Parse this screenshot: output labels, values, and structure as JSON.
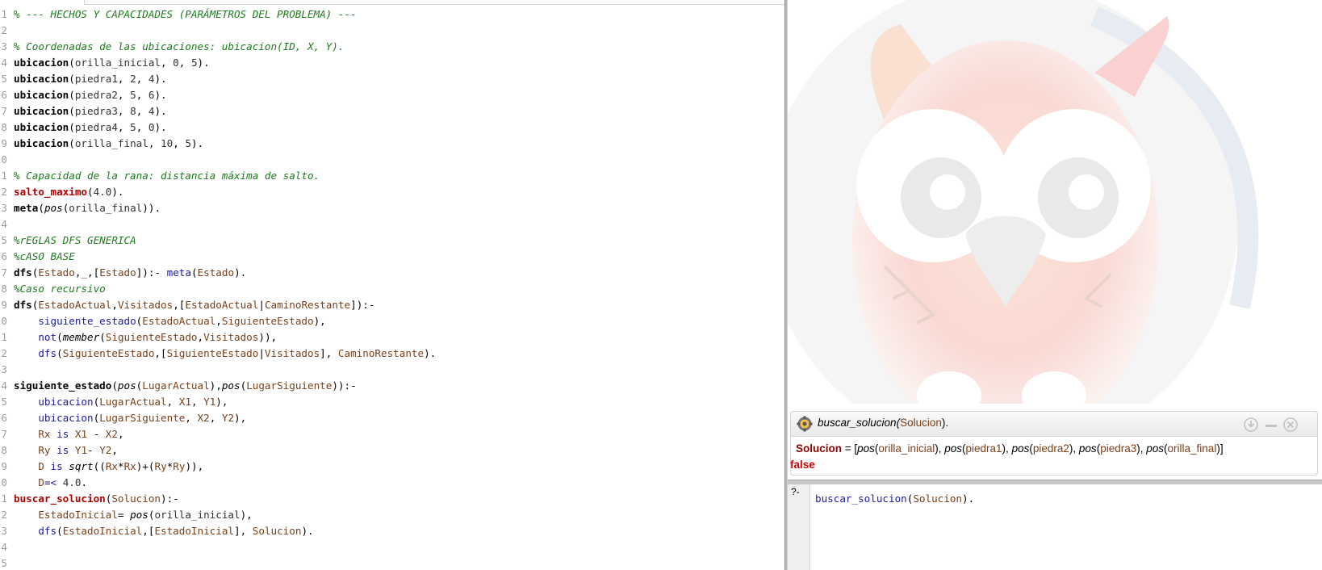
{
  "editor": {
    "lines": [
      {
        "n": "1",
        "tokens": [
          {
            "t": "% --- HECHOS Y CAPACIDADES (PARÁMETROS DEL PROBLEMA) ---",
            "c": "cm"
          }
        ]
      },
      {
        "n": "2",
        "tokens": []
      },
      {
        "n": "3",
        "tokens": [
          {
            "t": "% Coordenadas de las ubicaciones: ubicacion(ID, X, Y).",
            "c": "cm"
          }
        ]
      },
      {
        "n": "4",
        "tokens": [
          {
            "t": "ubicacion",
            "c": "hd"
          },
          {
            "t": "(",
            "c": "pn"
          },
          {
            "t": "orilla_inicial",
            "c": "at"
          },
          {
            "t": ", ",
            "c": "pn"
          },
          {
            "t": "0",
            "c": "nm"
          },
          {
            "t": ", ",
            "c": "pn"
          },
          {
            "t": "5",
            "c": "nm"
          },
          {
            "t": ").",
            "c": "pn"
          }
        ]
      },
      {
        "n": "5",
        "tokens": [
          {
            "t": "ubicacion",
            "c": "hd"
          },
          {
            "t": "(",
            "c": "pn"
          },
          {
            "t": "piedra1",
            "c": "at"
          },
          {
            "t": ", ",
            "c": "pn"
          },
          {
            "t": "2",
            "c": "nm"
          },
          {
            "t": ", ",
            "c": "pn"
          },
          {
            "t": "4",
            "c": "nm"
          },
          {
            "t": ").",
            "c": "pn"
          }
        ]
      },
      {
        "n": "6",
        "tokens": [
          {
            "t": "ubicacion",
            "c": "hd"
          },
          {
            "t": "(",
            "c": "pn"
          },
          {
            "t": "piedra2",
            "c": "at"
          },
          {
            "t": ", ",
            "c": "pn"
          },
          {
            "t": "5",
            "c": "nm"
          },
          {
            "t": ", ",
            "c": "pn"
          },
          {
            "t": "6",
            "c": "nm"
          },
          {
            "t": ").",
            "c": "pn"
          }
        ]
      },
      {
        "n": "7",
        "tokens": [
          {
            "t": "ubicacion",
            "c": "hd"
          },
          {
            "t": "(",
            "c": "pn"
          },
          {
            "t": "piedra3",
            "c": "at"
          },
          {
            "t": ", ",
            "c": "pn"
          },
          {
            "t": "8",
            "c": "nm"
          },
          {
            "t": ", ",
            "c": "pn"
          },
          {
            "t": "4",
            "c": "nm"
          },
          {
            "t": ").",
            "c": "pn"
          }
        ]
      },
      {
        "n": "8",
        "tokens": [
          {
            "t": "ubicacion",
            "c": "hd"
          },
          {
            "t": "(",
            "c": "pn"
          },
          {
            "t": "piedra4",
            "c": "at"
          },
          {
            "t": ", ",
            "c": "pn"
          },
          {
            "t": "5",
            "c": "nm"
          },
          {
            "t": ", ",
            "c": "pn"
          },
          {
            "t": "0",
            "c": "nm"
          },
          {
            "t": ").",
            "c": "pn"
          }
        ]
      },
      {
        "n": "9",
        "tokens": [
          {
            "t": "ubicacion",
            "c": "hd"
          },
          {
            "t": "(",
            "c": "pn"
          },
          {
            "t": "orilla_final",
            "c": "at"
          },
          {
            "t": ", ",
            "c": "pn"
          },
          {
            "t": "10",
            "c": "nm"
          },
          {
            "t": ", ",
            "c": "pn"
          },
          {
            "t": "5",
            "c": "nm"
          },
          {
            "t": ").",
            "c": "pn"
          }
        ]
      },
      {
        "n": "0",
        "tokens": []
      },
      {
        "n": "1",
        "tokens": [
          {
            "t": "% Capacidad de la rana: distancia máxima de salto.",
            "c": "cm"
          }
        ]
      },
      {
        "n": "2",
        "tokens": [
          {
            "t": "salto_maximo",
            "c": "hdx"
          },
          {
            "t": "(",
            "c": "pn"
          },
          {
            "t": "4.0",
            "c": "nm"
          },
          {
            "t": ").",
            "c": "pn"
          }
        ]
      },
      {
        "n": "3",
        "tokens": [
          {
            "t": "meta",
            "c": "hd"
          },
          {
            "t": "(",
            "c": "pn"
          },
          {
            "t": "pos",
            "c": "it"
          },
          {
            "t": "(",
            "c": "pn"
          },
          {
            "t": "orilla_final",
            "c": "at"
          },
          {
            "t": ")).",
            "c": "pn"
          }
        ]
      },
      {
        "n": "4",
        "tokens": []
      },
      {
        "n": "5",
        "tokens": [
          {
            "t": "%rEGLAS DFS GENERICA",
            "c": "cm"
          }
        ]
      },
      {
        "n": "6",
        "tokens": [
          {
            "t": "%cASO BASE",
            "c": "cm"
          }
        ]
      },
      {
        "n": "7",
        "tokens": [
          {
            "t": "dfs",
            "c": "hd"
          },
          {
            "t": "(",
            "c": "pn"
          },
          {
            "t": "Estado",
            "c": "vr"
          },
          {
            "t": ",",
            "c": "pn"
          },
          {
            "t": "_",
            "c": "vr"
          },
          {
            "t": ",[",
            "c": "pn"
          },
          {
            "t": "Estado",
            "c": "vr"
          },
          {
            "t": "]):- ",
            "c": "pn"
          },
          {
            "t": "meta",
            "c": "bi"
          },
          {
            "t": "(",
            "c": "pn"
          },
          {
            "t": "Estado",
            "c": "vr"
          },
          {
            "t": ").",
            "c": "pn"
          }
        ]
      },
      {
        "n": "8",
        "tokens": [
          {
            "t": "%Caso recursivo",
            "c": "cm"
          }
        ]
      },
      {
        "n": "9",
        "tokens": [
          {
            "t": "dfs",
            "c": "hd"
          },
          {
            "t": "(",
            "c": "pn"
          },
          {
            "t": "EstadoActual",
            "c": "vr"
          },
          {
            "t": ",",
            "c": "pn"
          },
          {
            "t": "Visitados",
            "c": "vr"
          },
          {
            "t": ",[",
            "c": "pn"
          },
          {
            "t": "EstadoActual",
            "c": "vr"
          },
          {
            "t": "|",
            "c": "pn"
          },
          {
            "t": "CaminoRestante",
            "c": "vr"
          },
          {
            "t": "]):-",
            "c": "pn"
          }
        ]
      },
      {
        "n": "0",
        "tokens": [
          {
            "t": "    ",
            "c": "pn"
          },
          {
            "t": "siguiente_estado",
            "c": "bi"
          },
          {
            "t": "(",
            "c": "pn"
          },
          {
            "t": "EstadoActual",
            "c": "vr"
          },
          {
            "t": ",",
            "c": "pn"
          },
          {
            "t": "SiguienteEstado",
            "c": "vr"
          },
          {
            "t": "),",
            "c": "pn"
          }
        ]
      },
      {
        "n": "1",
        "tokens": [
          {
            "t": "    ",
            "c": "pn"
          },
          {
            "t": "not",
            "c": "bi"
          },
          {
            "t": "(",
            "c": "pn"
          },
          {
            "t": "member",
            "c": "it"
          },
          {
            "t": "(",
            "c": "pn"
          },
          {
            "t": "SiguienteEstado",
            "c": "vr"
          },
          {
            "t": ",",
            "c": "pn"
          },
          {
            "t": "Visitados",
            "c": "vr"
          },
          {
            "t": ")),",
            "c": "pn"
          }
        ]
      },
      {
        "n": "2",
        "tokens": [
          {
            "t": "    ",
            "c": "pn"
          },
          {
            "t": "dfs",
            "c": "bi"
          },
          {
            "t": "(",
            "c": "pn"
          },
          {
            "t": "SiguienteEstado",
            "c": "vr"
          },
          {
            "t": ",[",
            "c": "pn"
          },
          {
            "t": "SiguienteEstado",
            "c": "vr"
          },
          {
            "t": "|",
            "c": "pn"
          },
          {
            "t": "Visitados",
            "c": "vr"
          },
          {
            "t": "], ",
            "c": "pn"
          },
          {
            "t": "CaminoRestante",
            "c": "vr"
          },
          {
            "t": ").",
            "c": "pn"
          }
        ]
      },
      {
        "n": "3",
        "tokens": []
      },
      {
        "n": "4",
        "tokens": [
          {
            "t": "siguiente_estado",
            "c": "hd"
          },
          {
            "t": "(",
            "c": "pn"
          },
          {
            "t": "pos",
            "c": "it"
          },
          {
            "t": "(",
            "c": "pn"
          },
          {
            "t": "LugarActual",
            "c": "vr"
          },
          {
            "t": "),",
            "c": "pn"
          },
          {
            "t": "pos",
            "c": "it"
          },
          {
            "t": "(",
            "c": "pn"
          },
          {
            "t": "LugarSiguiente",
            "c": "vr"
          },
          {
            "t": ")):-",
            "c": "pn"
          }
        ]
      },
      {
        "n": "5",
        "tokens": [
          {
            "t": "    ",
            "c": "pn"
          },
          {
            "t": "ubicacion",
            "c": "bi"
          },
          {
            "t": "(",
            "c": "pn"
          },
          {
            "t": "LugarActual",
            "c": "vr"
          },
          {
            "t": ", ",
            "c": "pn"
          },
          {
            "t": "X1",
            "c": "vr"
          },
          {
            "t": ", ",
            "c": "pn"
          },
          {
            "t": "Y1",
            "c": "vr"
          },
          {
            "t": "),",
            "c": "pn"
          }
        ]
      },
      {
        "n": "6",
        "tokens": [
          {
            "t": "    ",
            "c": "pn"
          },
          {
            "t": "ubicacion",
            "c": "bi"
          },
          {
            "t": "(",
            "c": "pn"
          },
          {
            "t": "LugarSiguiente",
            "c": "vr"
          },
          {
            "t": ", ",
            "c": "pn"
          },
          {
            "t": "X2",
            "c": "vr"
          },
          {
            "t": ", ",
            "c": "pn"
          },
          {
            "t": "Y2",
            "c": "vr"
          },
          {
            "t": "),",
            "c": "pn"
          }
        ]
      },
      {
        "n": "7",
        "tokens": [
          {
            "t": "    ",
            "c": "pn"
          },
          {
            "t": "Rx",
            "c": "vr"
          },
          {
            "t": " ",
            "c": "pn"
          },
          {
            "t": "is",
            "c": "bi"
          },
          {
            "t": " ",
            "c": "pn"
          },
          {
            "t": "X1",
            "c": "vr"
          },
          {
            "t": " - ",
            "c": "pn"
          },
          {
            "t": "X2",
            "c": "vr"
          },
          {
            "t": ",",
            "c": "pn"
          }
        ]
      },
      {
        "n": "8",
        "tokens": [
          {
            "t": "    ",
            "c": "pn"
          },
          {
            "t": "Ry",
            "c": "vr"
          },
          {
            "t": " ",
            "c": "pn"
          },
          {
            "t": "is",
            "c": "bi"
          },
          {
            "t": " ",
            "c": "pn"
          },
          {
            "t": "Y1",
            "c": "vr"
          },
          {
            "t": "- ",
            "c": "pn"
          },
          {
            "t": "Y2",
            "c": "vr"
          },
          {
            "t": ",",
            "c": "pn"
          }
        ]
      },
      {
        "n": "9",
        "tokens": [
          {
            "t": "    ",
            "c": "pn"
          },
          {
            "t": "D",
            "c": "vr"
          },
          {
            "t": " ",
            "c": "pn"
          },
          {
            "t": "is",
            "c": "bi"
          },
          {
            "t": " ",
            "c": "pn"
          },
          {
            "t": "sqrt",
            "c": "it"
          },
          {
            "t": "((",
            "c": "pn"
          },
          {
            "t": "Rx",
            "c": "vr"
          },
          {
            "t": "*",
            "c": "pn"
          },
          {
            "t": "Rx",
            "c": "vr"
          },
          {
            "t": ")+(",
            "c": "pn"
          },
          {
            "t": "Ry",
            "c": "vr"
          },
          {
            "t": "*",
            "c": "pn"
          },
          {
            "t": "Ry",
            "c": "vr"
          },
          {
            "t": ")),",
            "c": "pn"
          }
        ]
      },
      {
        "n": "0",
        "tokens": [
          {
            "t": "    ",
            "c": "pn"
          },
          {
            "t": "D",
            "c": "vr"
          },
          {
            "t": "=<",
            "c": "bi"
          },
          {
            "t": " ",
            "c": "pn"
          },
          {
            "t": "4.0",
            "c": "nm"
          },
          {
            "t": ".",
            "c": "pn"
          }
        ]
      },
      {
        "n": "1",
        "tokens": [
          {
            "t": "buscar_solucion",
            "c": "hdx"
          },
          {
            "t": "(",
            "c": "pn"
          },
          {
            "t": "Solucion",
            "c": "vr"
          },
          {
            "t": "):-",
            "c": "pn"
          }
        ]
      },
      {
        "n": "2",
        "tokens": [
          {
            "t": "    ",
            "c": "pn"
          },
          {
            "t": "EstadoInicial",
            "c": "vr"
          },
          {
            "t": "= ",
            "c": "pn"
          },
          {
            "t": "pos",
            "c": "it"
          },
          {
            "t": "(",
            "c": "pn"
          },
          {
            "t": "orilla_inicial",
            "c": "at"
          },
          {
            "t": "),",
            "c": "pn"
          }
        ]
      },
      {
        "n": "3",
        "tokens": [
          {
            "t": "    ",
            "c": "pn"
          },
          {
            "t": "dfs",
            "c": "bi"
          },
          {
            "t": "(",
            "c": "pn"
          },
          {
            "t": "EstadoInicial",
            "c": "vr"
          },
          {
            "t": ",[",
            "c": "pn"
          },
          {
            "t": "EstadoInicial",
            "c": "vr"
          },
          {
            "t": "], ",
            "c": "pn"
          },
          {
            "t": "Solucion",
            "c": "vr"
          },
          {
            "t": ").",
            "c": "pn"
          }
        ]
      },
      {
        "n": "4",
        "tokens": []
      },
      {
        "n": "5",
        "tokens": []
      }
    ]
  },
  "answer": {
    "query_pred": "buscar_solucion",
    "query_arg": "Solucion",
    "query_end": ").",
    "binding_var": "Solucion",
    "binding_eq": " = [",
    "binding_items": [
      {
        "f": "pos",
        "a": "orilla_inicial"
      },
      {
        "f": "pos",
        "a": "piedra1"
      },
      {
        "f": "pos",
        "a": "piedra2"
      },
      {
        "f": "pos",
        "a": "piedra3"
      },
      {
        "f": "pos",
        "a": "orilla_final"
      }
    ],
    "binding_close": "]",
    "result": "false",
    "icons": {
      "gear": "gear-icon",
      "down": "arrow-down-icon",
      "minimize": "minimize-icon",
      "close": "close-icon"
    }
  },
  "query": {
    "prompt": "?-",
    "pred": "buscar_solucion",
    "open": "(",
    "arg": "Solucion",
    "close": ")."
  },
  "colors": {
    "comment": "#1e7a1e",
    "variable": "#7a3f1a",
    "builtin": "#1a1aa6",
    "head_red": "#b00000",
    "false": "#d00000"
  }
}
